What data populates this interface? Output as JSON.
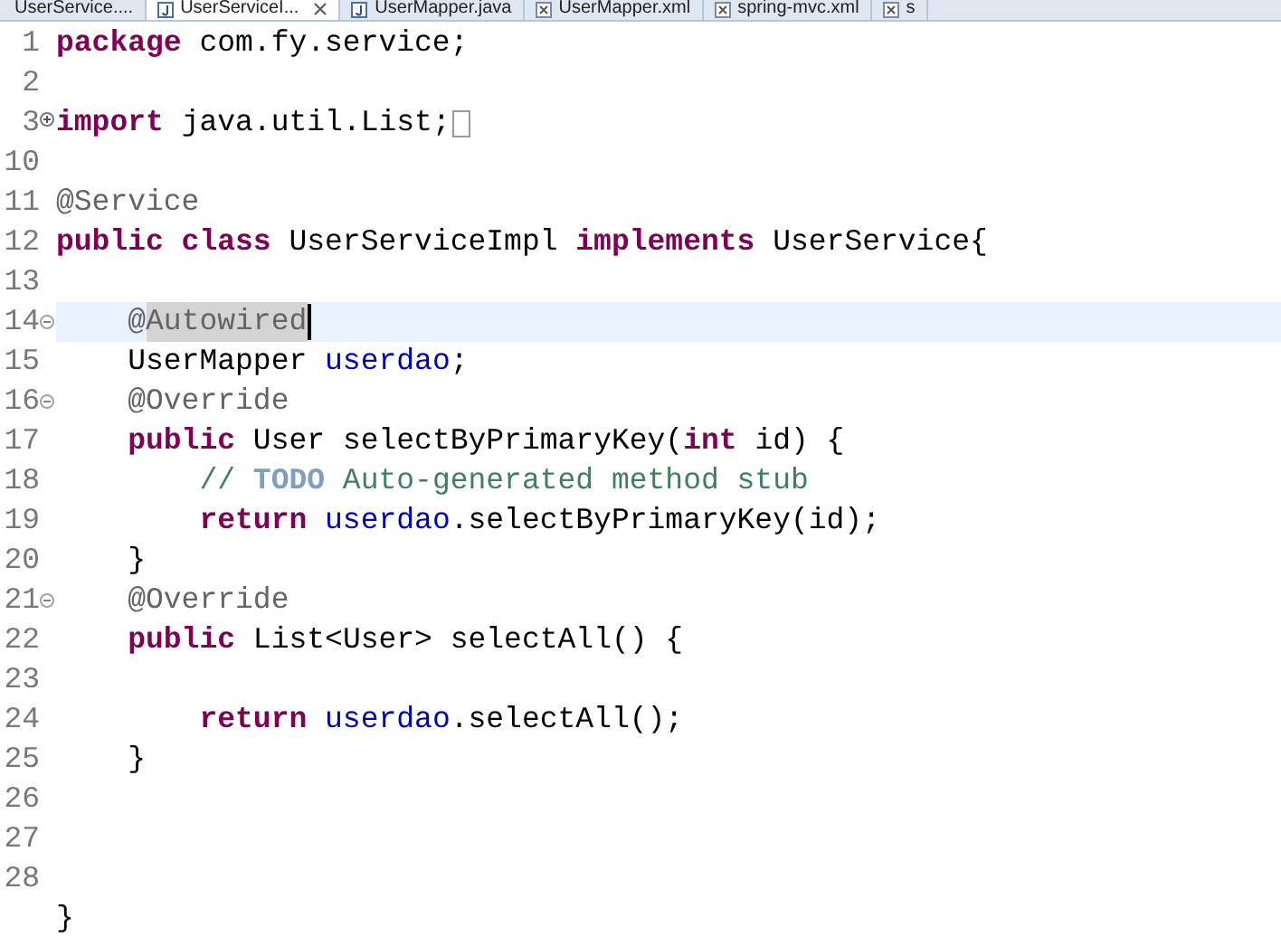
{
  "tabs": [
    {
      "label": "UserService....",
      "kind": "none",
      "selected": false
    },
    {
      "label": "UserServiceI...",
      "kind": "java",
      "selected": true
    },
    {
      "label": "UserMapper.java",
      "kind": "java",
      "selected": false
    },
    {
      "label": "UserMapper.xml",
      "kind": "xml",
      "selected": false
    },
    {
      "label": "spring-mvc.xml",
      "kind": "xml",
      "selected": false
    },
    {
      "label": "s",
      "kind": "xml",
      "selected": false
    }
  ],
  "lines": [
    {
      "number": "1",
      "current": false,
      "tokens": [
        {
          "kind": "keyword",
          "text": "package"
        },
        {
          "kind": "plain",
          "text": " com.fy.service;"
        }
      ]
    },
    {
      "number": "2",
      "current": false
    },
    {
      "number": "3",
      "current": false,
      "folded": true,
      "tokens": [
        {
          "kind": "keyword",
          "text": "import"
        },
        {
          "kind": "plain",
          "text": " java.util.List;"
        }
      ]
    },
    {
      "number": "10",
      "current": false
    },
    {
      "number": "11",
      "current": false,
      "tokens": [
        {
          "kind": "annotation",
          "text": "@Service"
        }
      ]
    },
    {
      "number": "12",
      "current": false,
      "tokens": [
        {
          "kind": "keyword",
          "text": "public class"
        },
        {
          "kind": "plain",
          "text": " UserServiceImpl "
        },
        {
          "kind": "keyword",
          "text": "implements"
        },
        {
          "kind": "plain",
          "text": " UserService{"
        }
      ]
    },
    {
      "number": "13",
      "current": false
    },
    {
      "number": "14",
      "current": true,
      "folded": false,
      "tokens": [
        {
          "kind": "annotation",
          "text": "    @",
          "selected": false
        },
        {
          "kind": "annotation",
          "text": "Autowired",
          "selected": true
        }
      ]
    },
    {
      "number": "15",
      "current": false,
      "tokens": [
        {
          "kind": "plain",
          "text": "    UserMapper "
        },
        {
          "kind": "field",
          "text": "userdao"
        },
        {
          "kind": "plain",
          "text": ";"
        }
      ]
    },
    {
      "number": "16",
      "current": false,
      "folded": false,
      "tokens": [
        {
          "kind": "annotation",
          "text": "    @Override"
        }
      ]
    },
    {
      "number": "17",
      "current": false,
      "tokens": [
        {
          "kind": "keyword",
          "text": "    public"
        },
        {
          "kind": "plain",
          "text": " User selectByPrimaryKey("
        },
        {
          "kind": "keyword",
          "text": "int"
        },
        {
          "kind": "plain",
          "text": " id) {"
        }
      ]
    },
    {
      "number": "18",
      "current": false,
      "tokens": [
        {
          "kind": "comment",
          "text": "        // "
        },
        {
          "kind": "todo",
          "text": "TODO"
        },
        {
          "kind": "comment",
          "text": " Auto-generated method stub"
        }
      ]
    },
    {
      "number": "19",
      "current": false,
      "tokens": [
        {
          "kind": "keyword",
          "text": "        return "
        },
        {
          "kind": "field",
          "text": "userdao"
        },
        {
          "kind": "plain",
          "text": ".selectByPrimaryKey(id);"
        }
      ]
    },
    {
      "number": "20",
      "current": false,
      "tokens": [
        {
          "kind": "plain",
          "text": "    }"
        }
      ]
    },
    {
      "number": "21",
      "current": false,
      "folded": false,
      "tokens": [
        {
          "kind": "annotation",
          "text": "    @Override"
        }
      ]
    },
    {
      "number": "22",
      "current": false,
      "tokens": [
        {
          "kind": "keyword",
          "text": "    public"
        },
        {
          "kind": "plain",
          "text": " List<User> selectAll() {"
        }
      ]
    },
    {
      "number": "23",
      "current": false
    },
    {
      "number": "24",
      "current": false,
      "tokens": [
        {
          "kind": "keyword",
          "text": "        return "
        },
        {
          "kind": "field",
          "text": "userdao"
        },
        {
          "kind": "plain",
          "text": ".selectAll();"
        }
      ]
    },
    {
      "number": "25",
      "current": false,
      "tokens": [
        {
          "kind": "plain",
          "text": "    }"
        }
      ]
    },
    {
      "number": "26",
      "current": false
    },
    {
      "number": "27",
      "current": false
    },
    {
      "number": "28",
      "current": false
    },
    {
      "current": false,
      "tokens": [
        {
          "kind": "plain",
          "text": "}"
        }
      ]
    }
  ]
}
